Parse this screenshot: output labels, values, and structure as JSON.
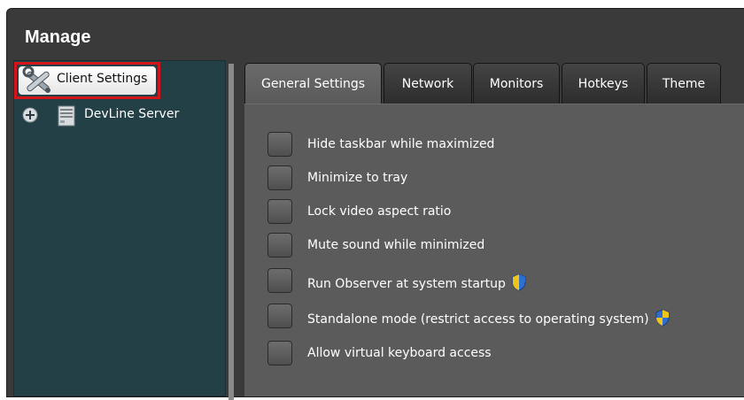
{
  "window": {
    "title": "Manage"
  },
  "tree": {
    "client_settings": "Client Settings",
    "server": "DevLine Server"
  },
  "tabs": [
    {
      "label": "General Settings",
      "active": true
    },
    {
      "label": "Network",
      "active": false
    },
    {
      "label": "Monitors",
      "active": false
    },
    {
      "label": "Hotkeys",
      "active": false
    },
    {
      "label": "Theme",
      "active": false
    }
  ],
  "options": [
    {
      "label": "Hide taskbar while maximized",
      "checked": false,
      "shield": false
    },
    {
      "label": "Minimize to tray",
      "checked": false,
      "shield": false
    },
    {
      "label": "Lock video aspect ratio",
      "checked": false,
      "shield": false
    },
    {
      "label": "Mute sound while minimized",
      "checked": false,
      "shield": false
    },
    {
      "label": "Run Observer at system startup",
      "checked": false,
      "shield": true
    },
    {
      "label": "Standalone mode (restrict access to operating system)",
      "checked": false,
      "shield": true
    },
    {
      "label": "Allow virtual keyboard access",
      "checked": false,
      "shield": false
    }
  ],
  "colors": {
    "highlight": "#d3141a",
    "tree_bg": "#234046",
    "pane_bg": "#5b5b5b"
  }
}
